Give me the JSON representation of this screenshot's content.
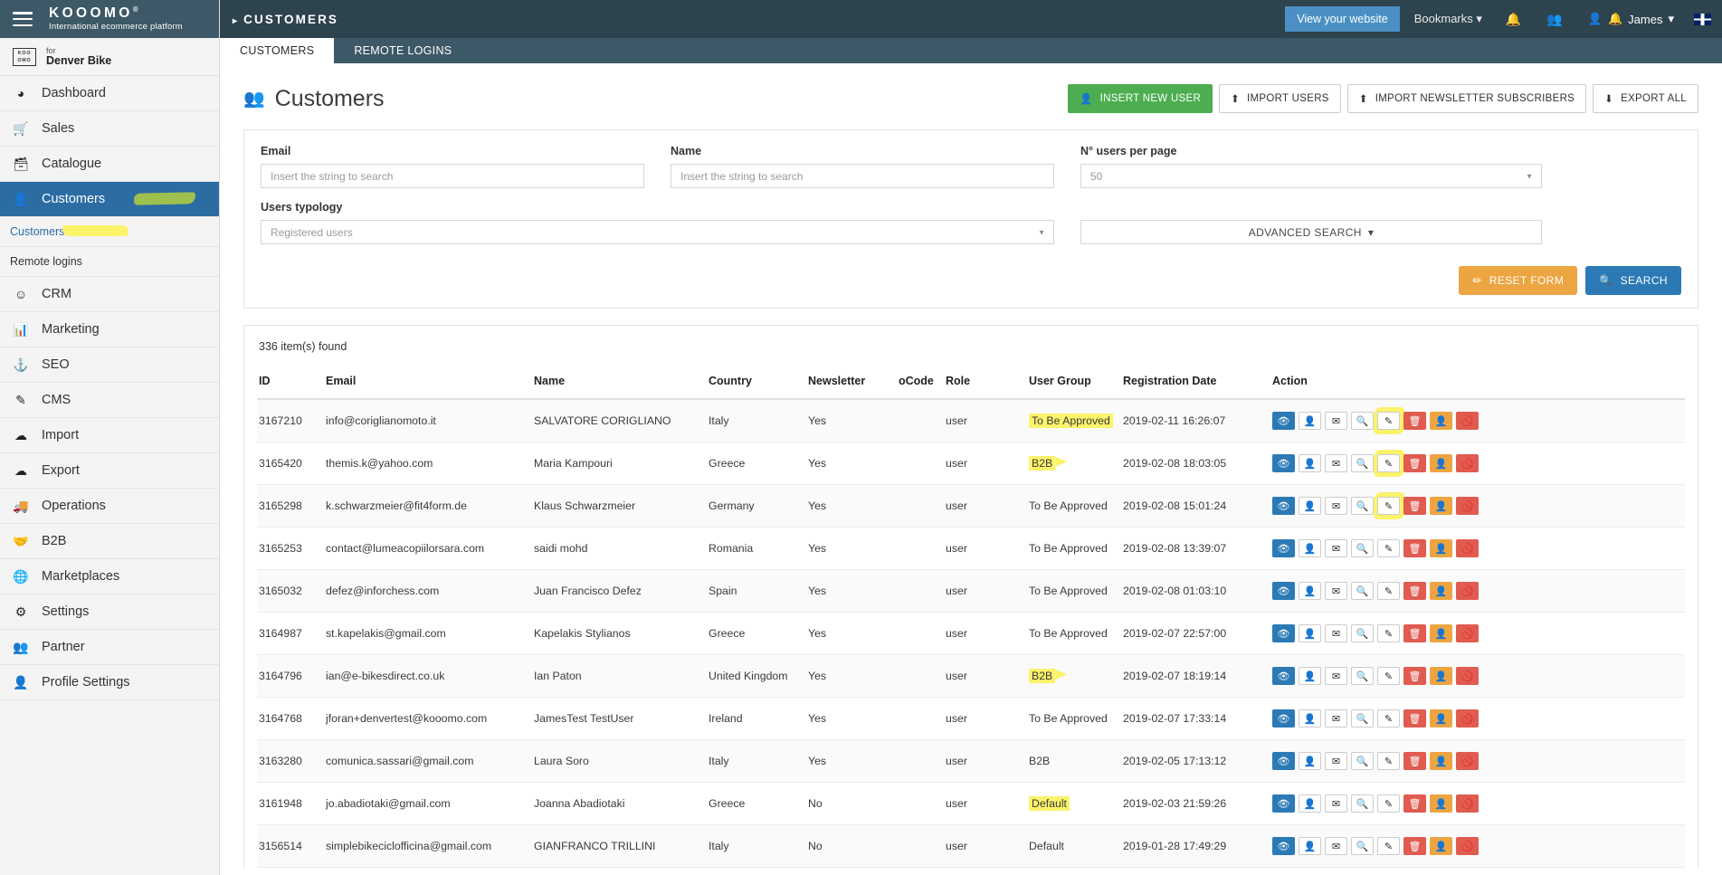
{
  "brand": {
    "name": "KOOOMO",
    "registered": "®",
    "tagline": "International ecommerce platform",
    "store_for": "for",
    "store_name": "Denver Bike",
    "store_logo": "KOO OMO"
  },
  "sidebar": {
    "items": [
      {
        "label": "Dashboard",
        "icon": "dashboard-icon",
        "glyph": "◕"
      },
      {
        "label": "Sales",
        "icon": "cart-icon",
        "glyph": "🛒"
      },
      {
        "label": "Catalogue",
        "icon": "box-icon",
        "glyph": "🗃"
      },
      {
        "label": "Customers",
        "icon": "user-icon",
        "glyph": "👤",
        "active": true
      },
      {
        "label": "CRM",
        "icon": "smiley-icon",
        "glyph": "☺"
      },
      {
        "label": "Marketing",
        "icon": "bar-chart-icon",
        "glyph": "📊"
      },
      {
        "label": "SEO",
        "icon": "anchor-icon",
        "glyph": "⚓"
      },
      {
        "label": "CMS",
        "icon": "edit-square-icon",
        "glyph": "✎"
      },
      {
        "label": "Import",
        "icon": "cloud-upload-icon",
        "glyph": "☁"
      },
      {
        "label": "Export",
        "icon": "cloud-download-icon",
        "glyph": "☁"
      },
      {
        "label": "Operations",
        "icon": "truck-icon",
        "glyph": "🚚"
      },
      {
        "label": "B2B",
        "icon": "handshake-icon",
        "glyph": "🤝"
      },
      {
        "label": "Marketplaces",
        "icon": "globe-icon",
        "glyph": "🌐"
      },
      {
        "label": "Settings",
        "icon": "gear-icon",
        "glyph": "⚙"
      },
      {
        "label": "Partner",
        "icon": "users-icon",
        "glyph": "👥"
      },
      {
        "label": "Profile Settings",
        "icon": "user-icon",
        "glyph": "👤"
      }
    ],
    "subitems": [
      {
        "label": "Customers",
        "highlighted": true
      },
      {
        "label": "Remote logins",
        "highlighted": false
      }
    ]
  },
  "topbar": {
    "breadcrumb": "CUSTOMERS",
    "view_site_label": "View your website",
    "bookmarks_label": "Bookmarks",
    "user_name": "James",
    "icons": [
      "bell-icon",
      "users-icon",
      "avatar-icon",
      "bell-alert-icon",
      "flag-icon"
    ]
  },
  "tabs": [
    {
      "label": "CUSTOMERS",
      "active": true
    },
    {
      "label": "REMOTE LOGINS",
      "active": false
    }
  ],
  "page": {
    "title": "Customers",
    "actions": [
      {
        "label": "INSERT NEW USER",
        "icon": "user-add-icon",
        "glyph": "👤",
        "style": "green"
      },
      {
        "label": "IMPORT USERS",
        "icon": "upload-icon",
        "glyph": "⬆",
        "style": "plain"
      },
      {
        "label": "IMPORT NEWSLETTER SUBSCRIBERS",
        "icon": "upload-icon",
        "glyph": "⬆",
        "style": "plain"
      },
      {
        "label": "EXPORT ALL",
        "icon": "download-icon",
        "glyph": "⬇",
        "style": "plain"
      }
    ]
  },
  "search": {
    "email_label": "Email",
    "email_placeholder": "Insert the string to search",
    "email_value": "",
    "name_label": "Name",
    "name_placeholder": "Insert the string to search",
    "name_value": "",
    "per_page_label": "N° users per page",
    "per_page_value": "50",
    "typology_label": "Users typology",
    "typology_value": "Registered users",
    "advanced_label": "ADVANCED SEARCH",
    "reset_label": "RESET FORM",
    "search_label": "SEARCH"
  },
  "table": {
    "found": "336 item(s) found",
    "columns": [
      "ID",
      "Email",
      "Name",
      "Country",
      "Newsletter",
      "oCode",
      "Role",
      "User Group",
      "Registration Date",
      "Action"
    ],
    "action_icons": [
      {
        "name": "eye-icon",
        "glyph": "👁",
        "style": "a-eye"
      },
      {
        "name": "user-icon",
        "glyph": "👤",
        "style": "a-plain"
      },
      {
        "name": "envelope-icon",
        "glyph": "✉",
        "style": "a-plain"
      },
      {
        "name": "search-icon",
        "glyph": "🔍",
        "style": "a-plain"
      },
      {
        "name": "edit-icon",
        "glyph": "✎",
        "style": "a-plain"
      },
      {
        "name": "trash-icon",
        "glyph": "🗑",
        "style": "a-red"
      },
      {
        "name": "person-icon",
        "glyph": "👤",
        "style": "a-org"
      },
      {
        "name": "ban-icon",
        "glyph": "🚫",
        "style": "a-red"
      }
    ],
    "rows": [
      {
        "id": "3167210",
        "email": "info@coriglianomoto.it",
        "name": "SALVATORE CORIGLIANO",
        "country": "Italy",
        "newsletter": "Yes",
        "ocode": "",
        "role": "user",
        "group": "To Be Approved",
        "group_marked": true,
        "date": "2019-02-11 16:26:07",
        "edit_marked": true
      },
      {
        "id": "3165420",
        "email": "themis.k@yahoo.com",
        "name": "Maria Kampouri",
        "country": "Greece",
        "newsletter": "Yes",
        "ocode": "",
        "role": "user",
        "group": "B2B",
        "group_marked": true,
        "date": "2019-02-08 18:03:05",
        "edit_marked": true
      },
      {
        "id": "3165298",
        "email": "k.schwarzmeier@fit4form.de",
        "name": "Klaus Schwarzmeier",
        "country": "Germany",
        "newsletter": "Yes",
        "ocode": "",
        "role": "user",
        "group": "To Be Approved",
        "group_marked": false,
        "date": "2019-02-08 15:01:24",
        "edit_marked": true
      },
      {
        "id": "3165253",
        "email": "contact@lumeacopiilorsara.com",
        "name": "saidi mohd",
        "country": "Romania",
        "newsletter": "Yes",
        "ocode": "",
        "role": "user",
        "group": "To Be Approved",
        "group_marked": false,
        "date": "2019-02-08 13:39:07",
        "edit_marked": false
      },
      {
        "id": "3165032",
        "email": "defez@inforchess.com",
        "name": "Juan Francisco Defez",
        "country": "Spain",
        "newsletter": "Yes",
        "ocode": "",
        "role": "user",
        "group": "To Be Approved",
        "group_marked": false,
        "date": "2019-02-08 01:03:10",
        "edit_marked": false
      },
      {
        "id": "3164987",
        "email": "st.kapelakis@gmail.com",
        "name": "Kapelakis Stylianos",
        "country": "Greece",
        "newsletter": "Yes",
        "ocode": "",
        "role": "user",
        "group": "To Be Approved",
        "group_marked": false,
        "date": "2019-02-07 22:57:00",
        "edit_marked": false
      },
      {
        "id": "3164796",
        "email": "ian@e-bikesdirect.co.uk",
        "name": "Ian Paton",
        "country": "United Kingdom",
        "newsletter": "Yes",
        "ocode": "",
        "role": "user",
        "group": "B2B",
        "group_marked": true,
        "date": "2019-02-07 18:19:14",
        "edit_marked": false
      },
      {
        "id": "3164768",
        "email": "jforan+denvertest@kooomo.com",
        "name": "JamesTest TestUser",
        "country": "Ireland",
        "newsletter": "Yes",
        "ocode": "",
        "role": "user",
        "group": "To Be Approved",
        "group_marked": false,
        "date": "2019-02-07 17:33:14",
        "edit_marked": false
      },
      {
        "id": "3163280",
        "email": "comunica.sassari@gmail.com",
        "name": "Laura Soro",
        "country": "Italy",
        "newsletter": "Yes",
        "ocode": "",
        "role": "user",
        "group": "B2B",
        "group_marked": false,
        "date": "2019-02-05 17:13:12",
        "edit_marked": false
      },
      {
        "id": "3161948",
        "email": "jo.abadiotaki@gmail.com",
        "name": "Joanna Abadiotaki",
        "country": "Greece",
        "newsletter": "No",
        "ocode": "",
        "role": "user",
        "group": "Default",
        "group_marked": true,
        "date": "2019-02-03 21:59:26",
        "edit_marked": false
      },
      {
        "id": "3156514",
        "email": "simplebikeciclofficina@gmail.com",
        "name": "GIANFRANCO TRILLINI",
        "country": "Italy",
        "newsletter": "No",
        "ocode": "",
        "role": "user",
        "group": "Default",
        "group_marked": false,
        "date": "2019-01-28 17:49:29",
        "edit_marked": false
      }
    ]
  },
  "colors": {
    "brand_dark": "#3d5866",
    "topbar": "#2d434e",
    "active_blue": "#2b6ca3",
    "green": "#4cae50",
    "orange": "#eda542",
    "red": "#e05b50",
    "highlight_yellow": "#fbf36a",
    "highlight_green": "#9ec04e"
  }
}
